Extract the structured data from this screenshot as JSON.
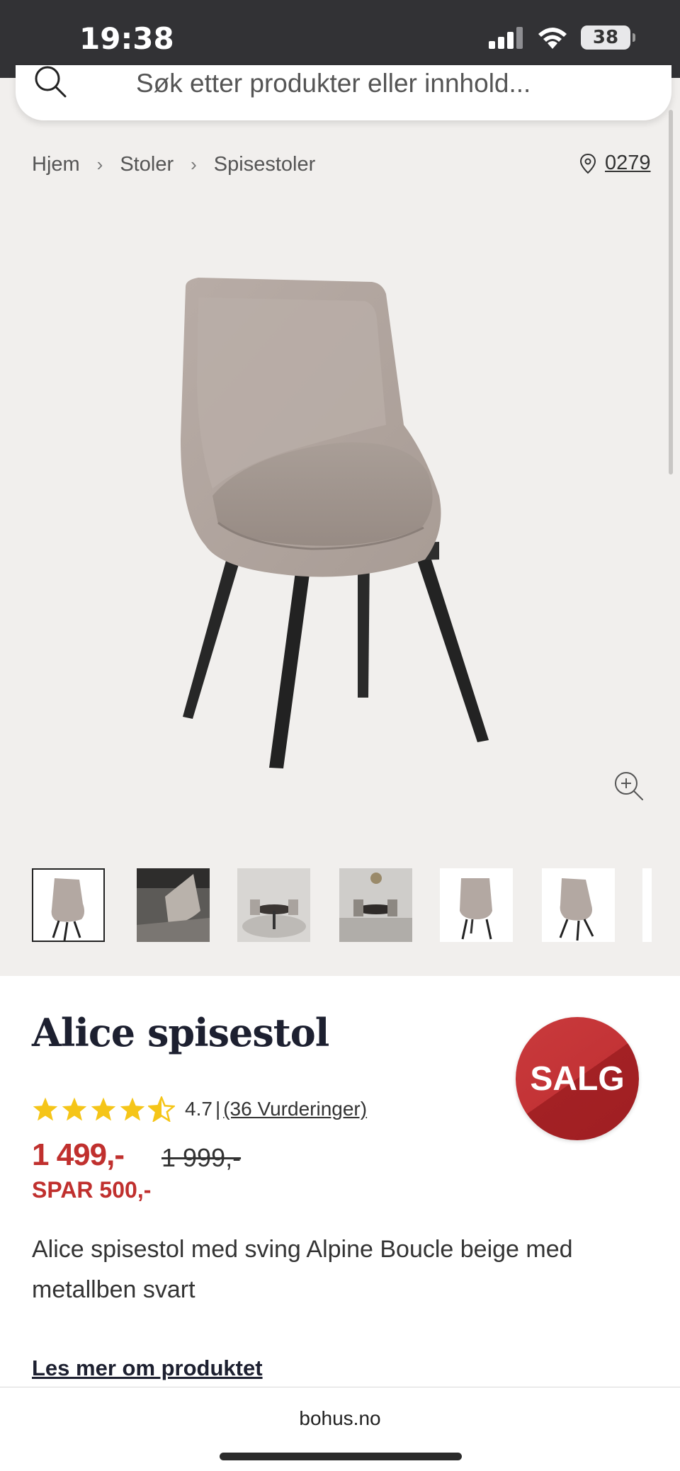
{
  "status": {
    "time": "19:38",
    "battery": "38"
  },
  "search": {
    "placeholder": "Søk etter produkter eller innhold..."
  },
  "breadcrumb": {
    "items": [
      "Hjem",
      "Stoler",
      "Spisestoler"
    ]
  },
  "store": {
    "number": "0279"
  },
  "product": {
    "title": "Alice spisestol",
    "badge": "SALG",
    "rating": {
      "value": "4.7",
      "separator": "|",
      "count_label": "(36 Vurderinger)",
      "stars": 4.5
    },
    "price": "1 499,-",
    "old_price": "1 999,-",
    "save": "SPAR 500,-",
    "description": "Alice spisestol med sving Alpine Boucle beige med metallben svart",
    "read_more": "Les mer om produktet"
  },
  "thumbnails": {
    "count": 7,
    "active_index": 0
  },
  "browser": {
    "domain": "bohus.no"
  },
  "colors": {
    "status_bar": "#323235",
    "background": "#f1efed",
    "sale_red": "#c0302e",
    "star": "#f5c518",
    "title_navy": "#1d2030"
  }
}
